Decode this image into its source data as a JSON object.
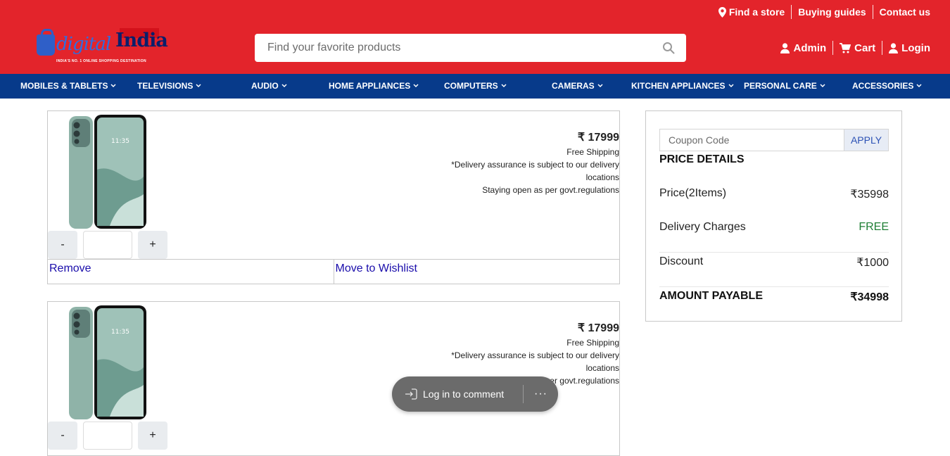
{
  "header": {
    "top_links": [
      {
        "label": "Find a store",
        "icon": "location-pin-icon"
      },
      {
        "label": "Buying guides"
      },
      {
        "label": "Contact us"
      }
    ],
    "logo": {
      "digital": "digital",
      "india": "India",
      "tagline": "INDIA'S NO. 1 ONLINE SHOPPING DESTINATION"
    },
    "search": {
      "placeholder": "Find your favorite products"
    },
    "user_links": [
      {
        "label": "Admin",
        "icon": "user-icon"
      },
      {
        "label": "Cart",
        "icon": "cart-icon"
      },
      {
        "label": "Login",
        "icon": "user-icon"
      }
    ],
    "colors": {
      "brand_red": "#e3242b",
      "nav_blue": "#073a8a"
    }
  },
  "nav": {
    "items": [
      "MOBILES & TABLETS",
      "TELEVISIONS",
      "AUDIO",
      "HOME APPLIANCES",
      "COMPUTERS",
      "CAMERAS",
      "KITCHEN APPLIANCES",
      "PERSONAL CARE",
      "ACCESSORIES"
    ]
  },
  "cart": {
    "items": [
      {
        "price": "₹ 17999",
        "shipping": "Free Shipping",
        "delivery_note": "*Delivery assurance is subject to our delivery locations",
        "open_note": "Staying open as per govt.regulations",
        "decrement": "-",
        "increment": "+",
        "quantity": "",
        "remove": "Remove",
        "wishlist": "Move to Wishlist"
      },
      {
        "price": "₹ 17999",
        "shipping": "Free Shipping",
        "delivery_note": "*Delivery assurance is subject to our delivery locations",
        "open_note": "Staying open as per govt.regulations",
        "decrement": "-",
        "increment": "+",
        "quantity": ""
      }
    ]
  },
  "summary": {
    "coupon_placeholder": "Coupon Code",
    "apply": "APPLY",
    "title": "PRICE DETAILS",
    "price_label": "Price(2Items)",
    "price_value": "₹35998",
    "delivery_label": "Delivery Charges",
    "delivery_value": "FREE",
    "discount_label": "Discount",
    "discount_value": "₹1000",
    "payable_label": "AMOUNT PAYABLE",
    "payable_value": "₹34998"
  },
  "comment_pill": {
    "label": "Log in to comment",
    "more": "···"
  }
}
